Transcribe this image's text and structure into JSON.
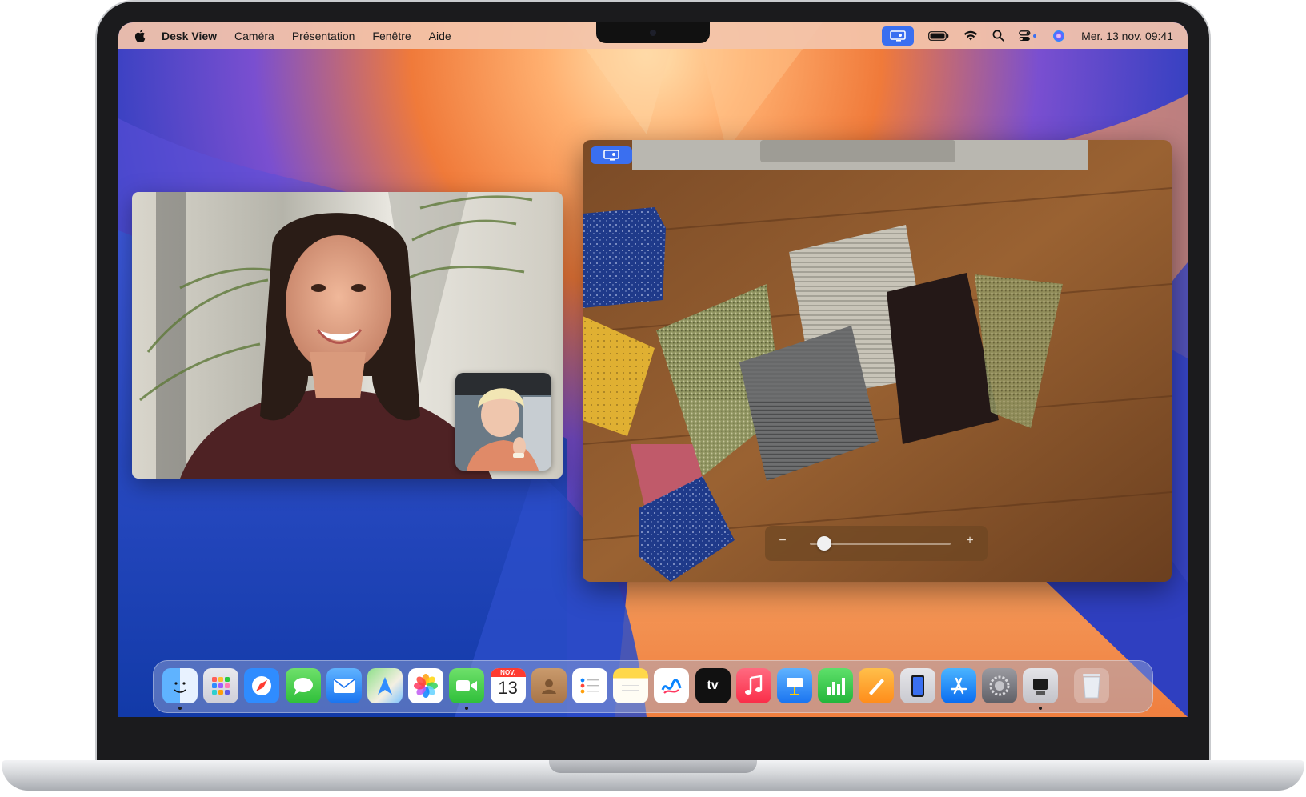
{
  "menubar": {
    "apple_icon": "apple-logo",
    "app_name": "Desk View",
    "items": [
      "Caméra",
      "Présentation",
      "Fenêtre",
      "Aide"
    ],
    "status_icons": [
      "desk-view-icon",
      "battery-icon",
      "wifi-icon",
      "search-icon",
      "control-center-icon",
      "siri-icon"
    ],
    "clock": "Mer. 13 nov.  09:41"
  },
  "facetime": {
    "main_feed": "remote-participant-video",
    "self_view": "self-preview-video"
  },
  "deskview": {
    "badge_icon": "desk-view-icon",
    "zoom": {
      "minus": "−",
      "plus": "+",
      "level": 0.1
    }
  },
  "dock": {
    "apps": [
      {
        "name": "Finder",
        "icon": "finder-icon",
        "running": true
      },
      {
        "name": "Launchpad",
        "icon": "launchpad-icon",
        "running": false
      },
      {
        "name": "Safari",
        "icon": "safari-icon",
        "running": false
      },
      {
        "name": "Messages",
        "icon": "messages-icon",
        "running": false
      },
      {
        "name": "Mail",
        "icon": "mail-icon",
        "running": false
      },
      {
        "name": "Plans",
        "icon": "maps-icon",
        "running": false
      },
      {
        "name": "Photos",
        "icon": "photos-icon",
        "running": false
      },
      {
        "name": "FaceTime",
        "icon": "facetime-icon",
        "running": true
      },
      {
        "name": "Calendrier",
        "icon": "calendar-icon",
        "running": false
      },
      {
        "name": "Contacts",
        "icon": "contacts-icon",
        "running": false
      },
      {
        "name": "Rappels",
        "icon": "reminders-icon",
        "running": false
      },
      {
        "name": "Notes",
        "icon": "notes-icon",
        "running": false
      },
      {
        "name": "Freeform",
        "icon": "freeform-icon",
        "running": false
      },
      {
        "name": "TV",
        "icon": "apple-tv-icon",
        "running": false
      },
      {
        "name": "Musique",
        "icon": "music-icon",
        "running": false
      },
      {
        "name": "Keynote",
        "icon": "keynote-icon",
        "running": false
      },
      {
        "name": "Numbers",
        "icon": "numbers-icon",
        "running": false
      },
      {
        "name": "Pages",
        "icon": "pages-icon",
        "running": false
      },
      {
        "name": "Recopie de l'iPhone",
        "icon": "iphone-mirroring-icon",
        "running": false
      },
      {
        "name": "App Store",
        "icon": "app-store-icon",
        "running": false
      },
      {
        "name": "Réglages Système",
        "icon": "system-settings-icon",
        "running": false
      },
      {
        "name": "Desk View",
        "icon": "desk-view-app-icon",
        "running": true
      },
      {
        "name": "Corbeille",
        "icon": "trash-icon",
        "running": false
      }
    ],
    "calendar": {
      "month": "NOV.",
      "day": "13"
    },
    "tv_label": "tv"
  },
  "colors": {
    "menubar_bg": "#f3c4aa",
    "accent_blue": "#3a6ff0",
    "wallpaper_blue": "#1d3fb0",
    "wallpaper_orange": "#f07a3a"
  }
}
